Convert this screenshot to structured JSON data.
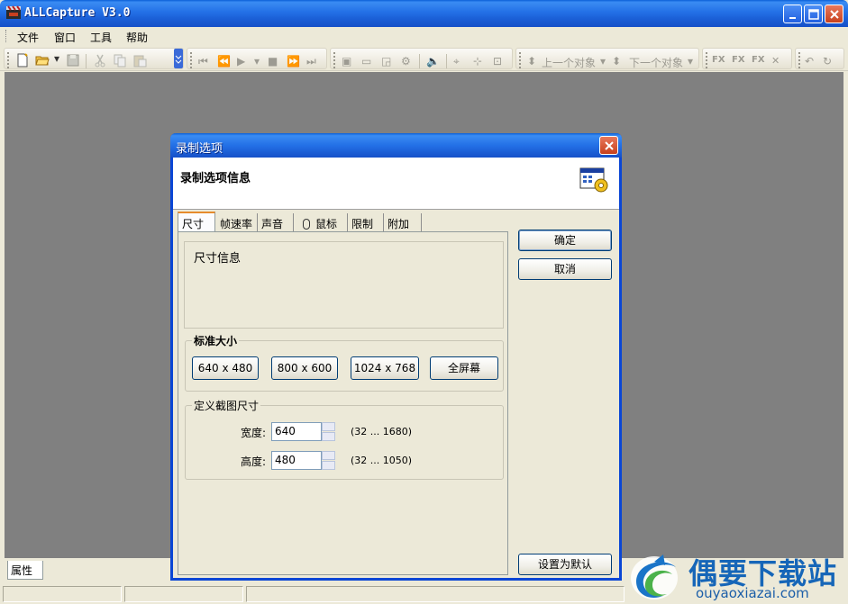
{
  "window": {
    "title": "ALLCapture V3.0",
    "menu": [
      "文件",
      "窗口",
      "工具",
      "帮助"
    ]
  },
  "toolbar": {
    "prev_object": "上一个对象",
    "next_object": "下一个对象"
  },
  "bottom": {
    "properties_tab": "属性"
  },
  "dialog": {
    "title": "录制选项",
    "header": "录制选项信息",
    "tabs": [
      "尺寸",
      "帧速率",
      "声音",
      "鼠标",
      "限制",
      "附加"
    ],
    "active_tab": "尺寸",
    "info_text": "尺寸信息",
    "standard_size": {
      "legend": "标准大小",
      "buttons": [
        "640 x 480",
        "800 x 600",
        "1024 x 768",
        "全屏幕"
      ]
    },
    "custom_size": {
      "legend": "定义截图尺寸",
      "width_label": "宽度:",
      "width_value": "640",
      "width_range": "(32 ... 1680)",
      "height_label": "高度:",
      "height_value": "480",
      "height_range": "(32 ... 1050)"
    },
    "ok": "确定",
    "cancel": "取消",
    "set_default": "设置为默认"
  },
  "watermark": {
    "cn": "偶要下载站",
    "en": "ouyaoxiazai.com"
  },
  "colors": {
    "titlebar": "#2370e6",
    "client_bg": "#808080",
    "dialog_bg": "#ece9d8",
    "watermark": "#1666b8"
  }
}
